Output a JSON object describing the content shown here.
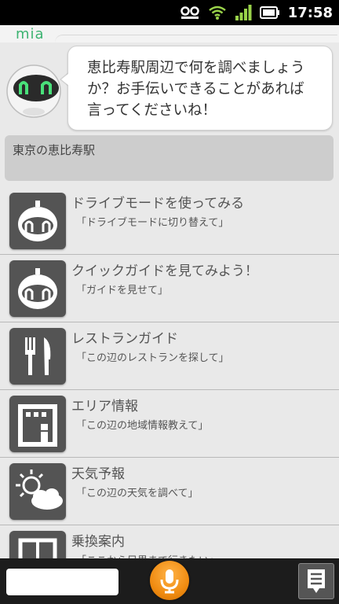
{
  "status_bar": {
    "time": "17:58",
    "icons": [
      "voicemail-icon",
      "wifi-icon",
      "signal-icon",
      "battery-icon"
    ]
  },
  "app": {
    "logo": "mia",
    "accent_color": "#3cb371"
  },
  "assistant": {
    "message_line1": "恵比寿駅周辺で何を調べましょう",
    "message_line2": "か？お手伝いできることがあれば",
    "message_line3": "言ってくださいね！"
  },
  "query": {
    "text": "東京の恵比寿駅"
  },
  "suggestions": [
    {
      "title": "ドライブモードを使ってみる",
      "subtitle": "「ドライブモードに切り替えて」",
      "icon": "robot-icon"
    },
    {
      "title": "クイックガイドを見てみよう！",
      "subtitle": "「ガイドを見せて」",
      "icon": "robot-icon"
    },
    {
      "title": "レストランガイド",
      "subtitle": "「この辺のレストランを探して」",
      "icon": "fork-knife-icon"
    },
    {
      "title": "エリア情報",
      "subtitle": "「この辺の地域情報教えて」",
      "icon": "building-icon"
    },
    {
      "title": "天気予報",
      "subtitle": "「この辺の天気を調べて」",
      "icon": "weather-icon"
    },
    {
      "title": "乗換案内",
      "subtitle": "「ここから目黒まで行きたい」",
      "icon": "train-icon"
    }
  ],
  "bottom_bar": {
    "input_value": "",
    "mic_color": "#f08c12"
  }
}
